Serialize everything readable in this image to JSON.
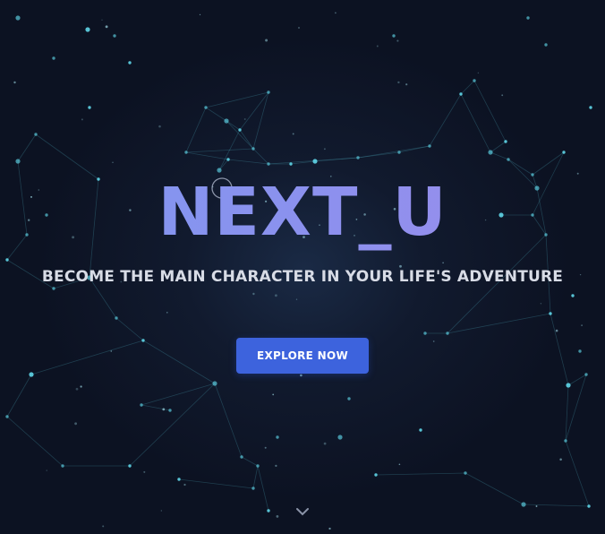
{
  "hero": {
    "title": "NEXT_U",
    "subtitle": "BECOME THE MAIN CHARACTER IN YOUR LIFE'S ADVENTURE",
    "cta_label": "EXPLORE NOW"
  },
  "icons": {
    "scroll_down": "chevron-down-icon"
  },
  "colors": {
    "background": "#0c1222",
    "title_gradient_start": "#7f98f0",
    "title_gradient_end": "#9d8ceb",
    "cta": "#3d63dd",
    "network": "#5fd6e8"
  }
}
